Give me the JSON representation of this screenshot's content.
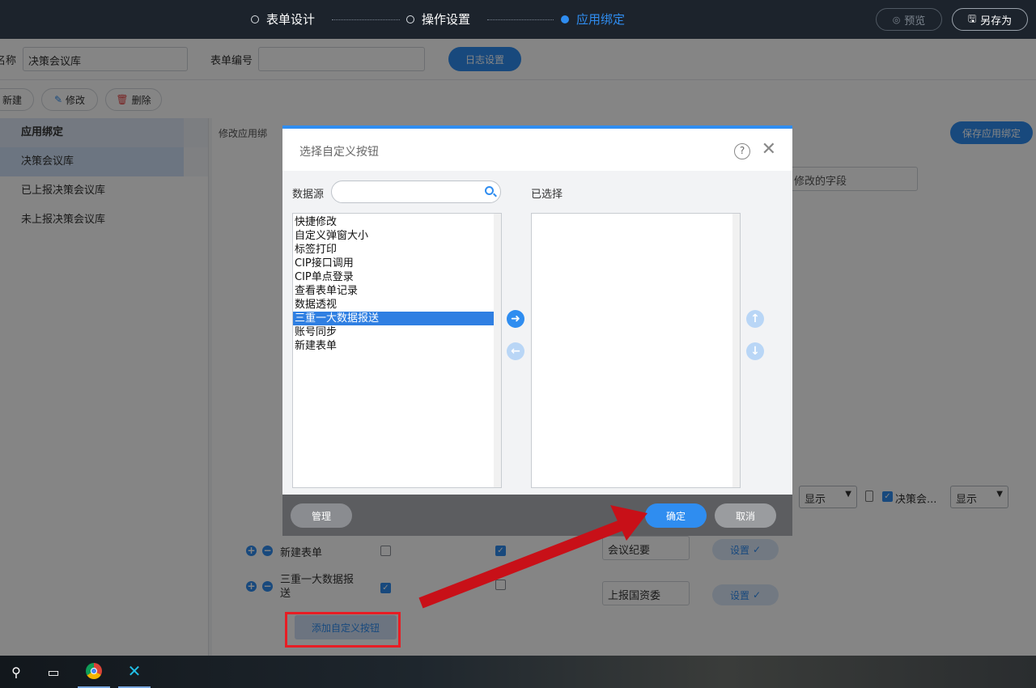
{
  "steps": [
    {
      "label": "表单设计",
      "active": false
    },
    {
      "label": "操作设置",
      "active": false
    },
    {
      "label": "应用绑定",
      "active": true
    }
  ],
  "toolbar": {
    "preview_label": "预览",
    "save_as_label": "另存为"
  },
  "form": {
    "name_label": "名称",
    "name_value": "决策会议库",
    "code_label": "表单编号",
    "code_value": "",
    "log_settings_label": "日志设置"
  },
  "actions": {
    "new_label": "新建",
    "edit_label": "修改",
    "delete_label": "删除"
  },
  "sidebar": {
    "items": [
      {
        "label": "应用绑定"
      },
      {
        "label": "决策会议库"
      },
      {
        "label": "已上报决策会议库"
      },
      {
        "label": "未上报决策会议库"
      }
    ]
  },
  "content": {
    "title": "修改应用绑",
    "save_binding_label": "保存应用绑定",
    "field_hint": "修改的字段",
    "show_option": "显示",
    "checkbox_label": "决策会...",
    "rows": [
      {
        "name": "新建表单",
        "text_value": "会议纪要",
        "set_label": "设置"
      },
      {
        "name": "三重一大数据报送",
        "text_value": "上报国资委",
        "set_label": "设置"
      }
    ],
    "add_custom_button_label": "添加自定义按钮"
  },
  "dialog": {
    "title": "选择自定义按钮",
    "source_label": "数据源",
    "search_placeholder": "",
    "selected_label": "已选择",
    "source_items": [
      "快捷修改",
      "自定义弹窗大小",
      "标签打印",
      "CIP接口调用",
      "CIP单点登录",
      "查看表单记录",
      "数据透视",
      "三重一大数据报送",
      "账号同步",
      "新建表单"
    ],
    "selected_index": 7,
    "selected_items": [],
    "manage_label": "管理",
    "ok_label": "确定",
    "cancel_label": "取消"
  },
  "colors": {
    "accent": "#2f8df0",
    "annotation": "#e81d24",
    "topbar": "#1c232c"
  }
}
